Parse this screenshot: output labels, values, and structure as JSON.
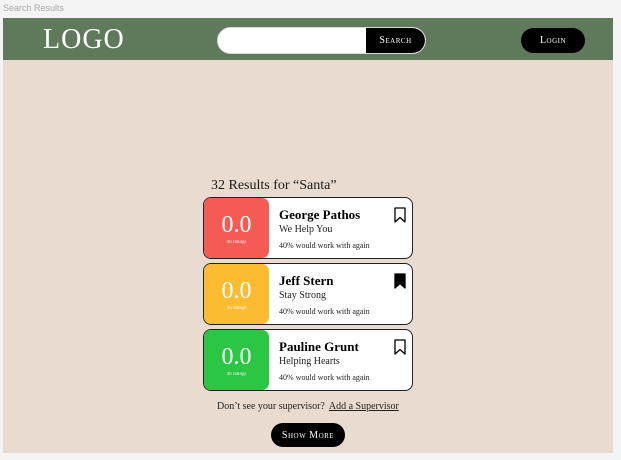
{
  "window": {
    "title": "Search Results"
  },
  "header": {
    "logo": "LOGO",
    "search_placeholder": "",
    "search_label": "Search",
    "login_label": "Login"
  },
  "results": {
    "heading": "32 Results for “Santa”",
    "items": [
      {
        "score": "0.0",
        "ratings": "46 ratings",
        "name": "George Pathos",
        "org": "We Help You",
        "pct": "40% would work with again",
        "bookmarked": false,
        "score_color": "#f55a55"
      },
      {
        "score": "0.0",
        "ratings": "46 ratings",
        "name": "Jeff Stern",
        "org": "Stay Strong",
        "pct": "40% would work with again",
        "bookmarked": true,
        "score_color": "#fcbc31"
      },
      {
        "score": "0.0",
        "ratings": "46 ratings",
        "name": "Pauline Grunt",
        "org": "Helping Hearts",
        "pct": "40% would work with again",
        "bookmarked": false,
        "score_color": "#2bc643"
      }
    ]
  },
  "footer": {
    "prompt": "Don’t see your supervisor?",
    "link": "Add a Supervisor",
    "show_more": "Show More"
  },
  "colors": {
    "header_bg": "#5f7a5b",
    "page_bg": "#e9dbcf",
    "button_bg": "#000000"
  }
}
